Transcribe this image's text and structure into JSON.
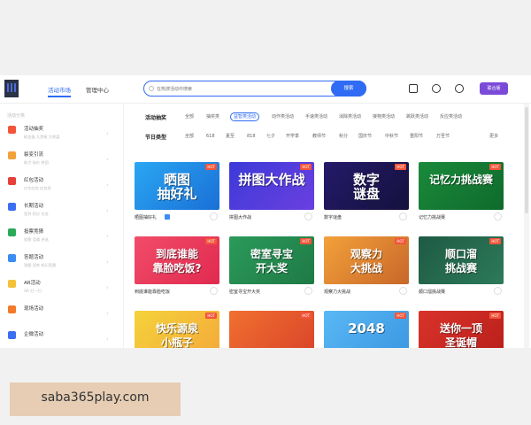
{
  "header": {
    "nav": [
      "活动市场",
      "管理中心"
    ],
    "search_placeholder": "在热搜活动中搜索",
    "search_button": "搜索",
    "vip_label": "联合版"
  },
  "sidebar": {
    "heading": "活动分类",
    "items": [
      {
        "title": "活动抽奖",
        "sub": "砸金蛋 九宫格 大转盘"
      },
      {
        "title": "裂变引流",
        "sub": "助力 砍价 拼团"
      },
      {
        "title": "红包活动",
        "sub": "口令红包 红包雨"
      },
      {
        "title": "长期活动",
        "sub": "签到 积分 任务"
      },
      {
        "title": "投票竞猜",
        "sub": "投票 竞猜 评选"
      },
      {
        "title": "答题活动",
        "sub": "答题 闯关 知识竞赛"
      },
      {
        "title": "AR活动",
        "sub": "AR 扫一扫"
      },
      {
        "title": "现场活动",
        "sub": ""
      },
      {
        "title": "企微活动",
        "sub": ""
      }
    ]
  },
  "filters": {
    "row1_label": "活动抽奖",
    "row1": [
      "全部",
      "抽奖类",
      "益智类活动",
      "动作类活动",
      "手速类活动",
      "消除类活动",
      "接物类活动",
      "跳跃类活动",
      "反应类活动"
    ],
    "row1_selected": 2,
    "row2_label": "节日类型",
    "row2": [
      "全部",
      "618",
      "夏至",
      "818",
      "七夕",
      "开学季",
      "教师节",
      "秋分",
      "国庆节",
      "中秋节",
      "重阳节",
      "万圣节"
    ],
    "more": "更多"
  },
  "cards": [
    {
      "name": "晒图抽好礼",
      "art": "晒图\n抽好礼",
      "bg1": "#2aa7f3",
      "bg2": "#1a6fd6",
      "hot": "HOT"
    },
    {
      "name": "拼图大作战",
      "art": "拼图大作战",
      "bg1": "#3c3ad8",
      "bg2": "#6b3fe0",
      "hot": "HOT"
    },
    {
      "name": "数字谜盘",
      "art": "数字\n谜盘",
      "bg1": "#241a6a",
      "bg2": "#15113d",
      "hot": "HOT"
    },
    {
      "name": "记忆力挑战赛",
      "art": "记忆力挑战赛",
      "bg1": "#1a8a3a",
      "bg2": "#0f6a2c",
      "hot": "HOT"
    },
    {
      "name": "到底谁能靠脸吃饭",
      "art": "到底谁能\n靠脸吃饭?",
      "bg1": "#f24c6a",
      "bg2": "#e02a4f",
      "hot": "HOT"
    },
    {
      "name": "密室寻宝开大奖",
      "art": "密室寻宝\n开大奖",
      "bg1": "#2a9a5a",
      "bg2": "#1f7a45",
      "hot": "HOT"
    },
    {
      "name": "观察力大挑战",
      "art": "观察力\n大挑战",
      "bg1": "#f3a13a",
      "bg2": "#c8672a",
      "hot": "HOT"
    },
    {
      "name": "顺口溜挑战赛",
      "art": "顺口溜\n挑战赛",
      "bg1": "#1e5a44",
      "bg2": "#2d7a5a",
      "hot": "HOT"
    },
    {
      "name": "快乐源泉小瓶子",
      "art": "快乐源泉\n小瓶子",
      "bg1": "#f5d23a",
      "bg2": "#f3a93a",
      "hot": "HOT"
    },
    {
      "name": "",
      "art": "",
      "bg1": "#f07030",
      "bg2": "#d9432a",
      "hot": "HOT"
    },
    {
      "name": "",
      "art": "2048",
      "bg1": "#5ab8f5",
      "bg2": "#3a96e0",
      "hot": "HOT"
    },
    {
      "name": "",
      "art": "送你一顶\n圣诞帽",
      "bg1": "#d9332a",
      "bg2": "#b81f1a",
      "hot": "HOT"
    }
  ],
  "watermark": "saba365play.com"
}
